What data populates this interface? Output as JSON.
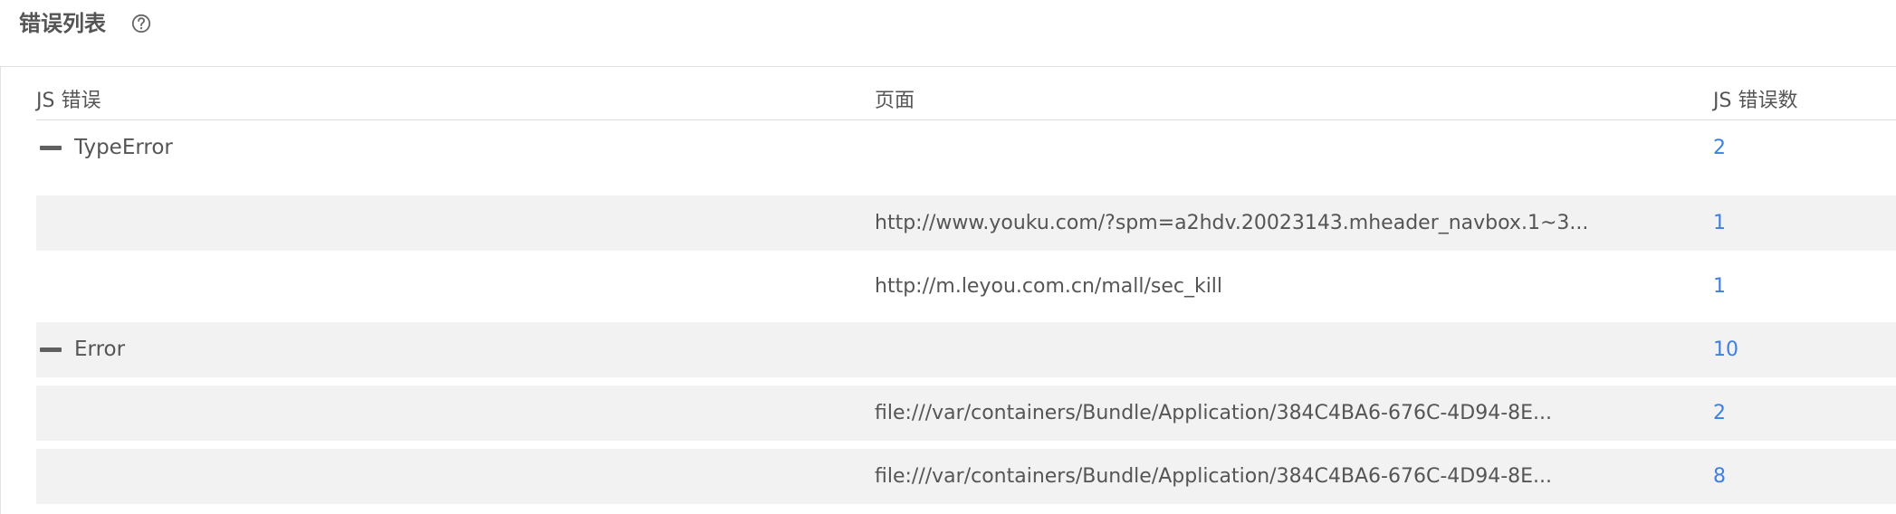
{
  "header": {
    "title": "错误列表",
    "help_icon": "question-circle-icon"
  },
  "table": {
    "columns": [
      "JS 错误",
      "页面",
      "JS 错误数"
    ],
    "rows": [
      {
        "type": "group",
        "label": "TypeError",
        "page": "",
        "count": "2",
        "expanded": true
      },
      {
        "type": "child",
        "label": "",
        "page": "http://www.youku.com/?spm=a2hdv.20023143.mheader_navbox.1~3...",
        "count": "1"
      },
      {
        "type": "child",
        "label": "",
        "page": "http://m.leyou.com.cn/mall/sec_kill",
        "count": "1"
      },
      {
        "type": "group",
        "label": "Error",
        "page": "",
        "count": "10",
        "expanded": true
      },
      {
        "type": "child",
        "label": "",
        "page": "file:///var/containers/Bundle/Application/384C4BA6-676C-4D94-8E...",
        "count": "2"
      },
      {
        "type": "child",
        "label": "",
        "page": "file:///var/containers/Bundle/Application/384C4BA6-676C-4D94-8E...",
        "count": "8"
      }
    ]
  },
  "colors": {
    "accent_link": "#3f7fe0",
    "row_alt_background": "#f2f2f2",
    "border": "#e3e3e3",
    "text": "#555555"
  }
}
